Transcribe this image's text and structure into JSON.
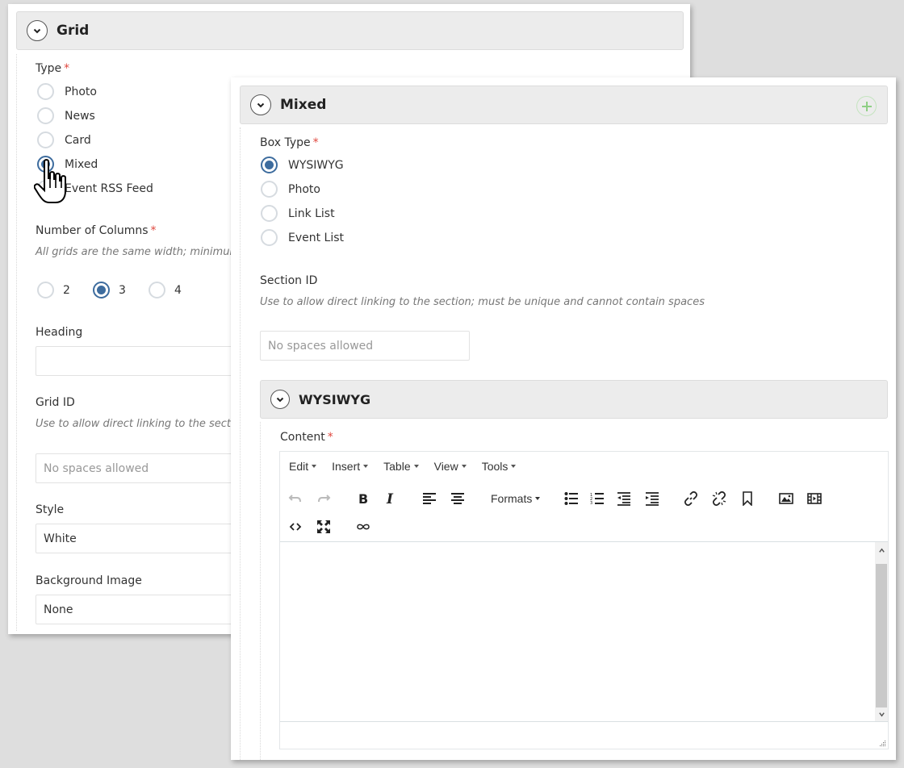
{
  "grid_panel": {
    "title": "Grid",
    "type_field": {
      "label": "Type",
      "required_mark": "*",
      "options": [
        "Photo",
        "News",
        "Card",
        "Mixed",
        "Event RSS Feed"
      ],
      "selected": "Mixed"
    },
    "columns_field": {
      "label": "Number of Columns",
      "required_mark": "*",
      "help": "All grids are the same width; minimum",
      "options": [
        "2",
        "3",
        "4"
      ],
      "selected": "3"
    },
    "heading_field": {
      "label": "Heading",
      "value": ""
    },
    "grid_id_field": {
      "label": "Grid ID",
      "help": "Use to allow direct linking to the section",
      "placeholder": "No spaces allowed"
    },
    "style_field": {
      "label": "Style",
      "value": "White"
    },
    "background_image_field": {
      "label": "Background Image",
      "value": "None"
    }
  },
  "mixed_panel": {
    "title": "Mixed",
    "add_button_icon": "plus-circle-icon",
    "box_type_field": {
      "label": "Box Type",
      "required_mark": "*",
      "options": [
        "WYSIWYG",
        "Photo",
        "Link List",
        "Event List"
      ],
      "selected": "WYSIWYG"
    },
    "section_id_field": {
      "label": "Section ID",
      "help": "Use to allow direct linking to the section; must be unique and cannot contain spaces",
      "placeholder": "No spaces allowed"
    },
    "wysiwyg_section": {
      "title": "WYSIWYG",
      "content_label": "Content",
      "required_mark": "*",
      "menubar": [
        "Edit",
        "Insert",
        "Table",
        "View",
        "Tools"
      ],
      "formats_label": "Formats",
      "toolbar_icons": [
        "undo-icon",
        "redo-icon",
        "bold-icon",
        "italic-icon",
        "align-left-icon",
        "align-center-icon",
        "bullet-list-icon",
        "numbered-list-icon",
        "outdent-icon",
        "indent-icon",
        "link-icon",
        "unlink-icon",
        "bookmark-icon",
        "image-icon",
        "media-icon",
        "source-code-icon",
        "fullscreen-icon",
        "infinity-icon"
      ],
      "content_value": ""
    }
  },
  "colors": {
    "accent": "#3d6c9e",
    "required": "#e0483f",
    "add_button": "#8fcf85",
    "header_bg": "#ececec",
    "backdrop": "#dedede"
  }
}
